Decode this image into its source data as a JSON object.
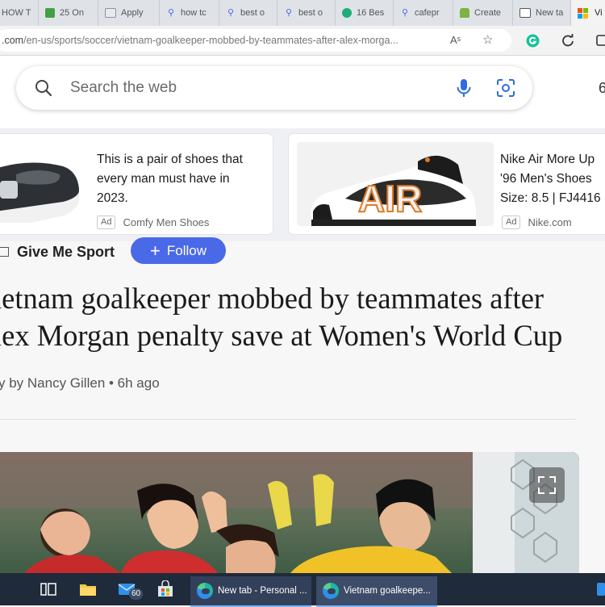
{
  "tabs": [
    {
      "label": "HOW T",
      "favicon_color": "#2e7d32",
      "favicon": "page"
    },
    {
      "label": "25 On",
      "favicon_color": "#43a047",
      "favicon": "image"
    },
    {
      "label": "Apply",
      "favicon_color": "#5c6bc0",
      "favicon": "page"
    },
    {
      "label": "how tc",
      "favicon_color": "#4a69e8",
      "favicon": "search"
    },
    {
      "label": "best o",
      "favicon_color": "#4a69e8",
      "favicon": "search"
    },
    {
      "label": "best o",
      "favicon_color": "#4a69e8",
      "favicon": "search"
    },
    {
      "label": "16 Bes",
      "favicon_color": "#1fae7a",
      "favicon": "circle"
    },
    {
      "label": "cafepr",
      "favicon_color": "#4a69e8",
      "favicon": "search"
    },
    {
      "label": "Create",
      "favicon_color": "#7cb342",
      "favicon": "shirt"
    },
    {
      "label": "New ta",
      "favicon_color": "#555555",
      "favicon": "newtab"
    },
    {
      "label": "Vi",
      "favicon_color": "#f25022",
      "favicon": "microsoft",
      "active": true
    }
  ],
  "address_bar": {
    "domain": ".com",
    "path": "/en-us/sports/soccer/vietnam-goalkeeper-mobbed-by-teammates-after-alex-morga...",
    "read_aloud_glyph": "Aˢ"
  },
  "search": {
    "placeholder": "Search the web",
    "edge_cut_text": "6"
  },
  "ads": [
    {
      "text_lines": [
        "This is a pair of shoes that",
        "every man must have in",
        "2023."
      ],
      "badge": "Ad",
      "source": "Comfy Men Shoes"
    },
    {
      "text_lines": [
        "Nike Air More Up",
        "'96 Men's Shoes",
        "Size: 8.5 | FJ4416"
      ],
      "badge": "Ad",
      "source": "Nike.com",
      "shoe_letters": "AIR"
    }
  ],
  "article": {
    "publisher": "Give Me Sport",
    "follow_label": "Follow",
    "headline_lines": [
      "ietnam goalkeeper mobbed by teammates after",
      "lex Morgan penalty save at Women's World Cup"
    ],
    "byline": "y by Nancy Gillen • 6h ago"
  },
  "taskbar": {
    "mail_badge": "60",
    "apps": [
      {
        "label": "New tab - Personal ...",
        "active": false
      },
      {
        "label": "Vietnam goalkeepe...",
        "active": true
      }
    ]
  },
  "colors": {
    "accent_blue": "#4a69e8",
    "taskbar": "#1f2a3a",
    "tabstrip": "#dfe3e8"
  }
}
